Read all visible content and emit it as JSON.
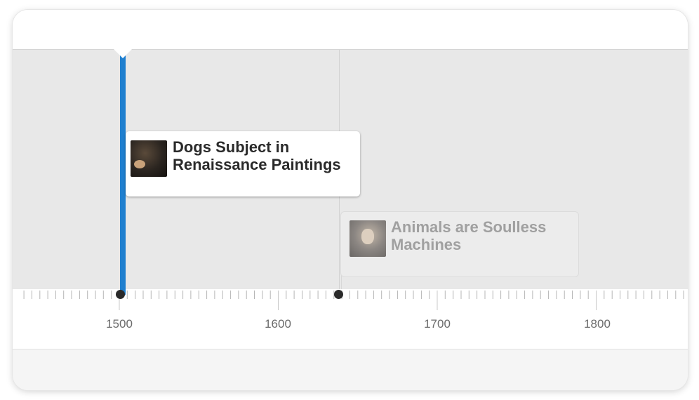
{
  "timeline": {
    "events": [
      {
        "title": "Dogs Subject in Renaissance Paintings",
        "state": "active",
        "thumbnail": "portrait-with-dog"
      },
      {
        "title": "Animals are Soulless Machines",
        "state": "inactive",
        "thumbnail": "portrait-of-man"
      }
    ],
    "axis": {
      "labels": [
        "1500",
        "1600",
        "1700",
        "1800"
      ]
    },
    "marker_color": "#1f7fcf",
    "background_color": "#e8e8e8"
  }
}
